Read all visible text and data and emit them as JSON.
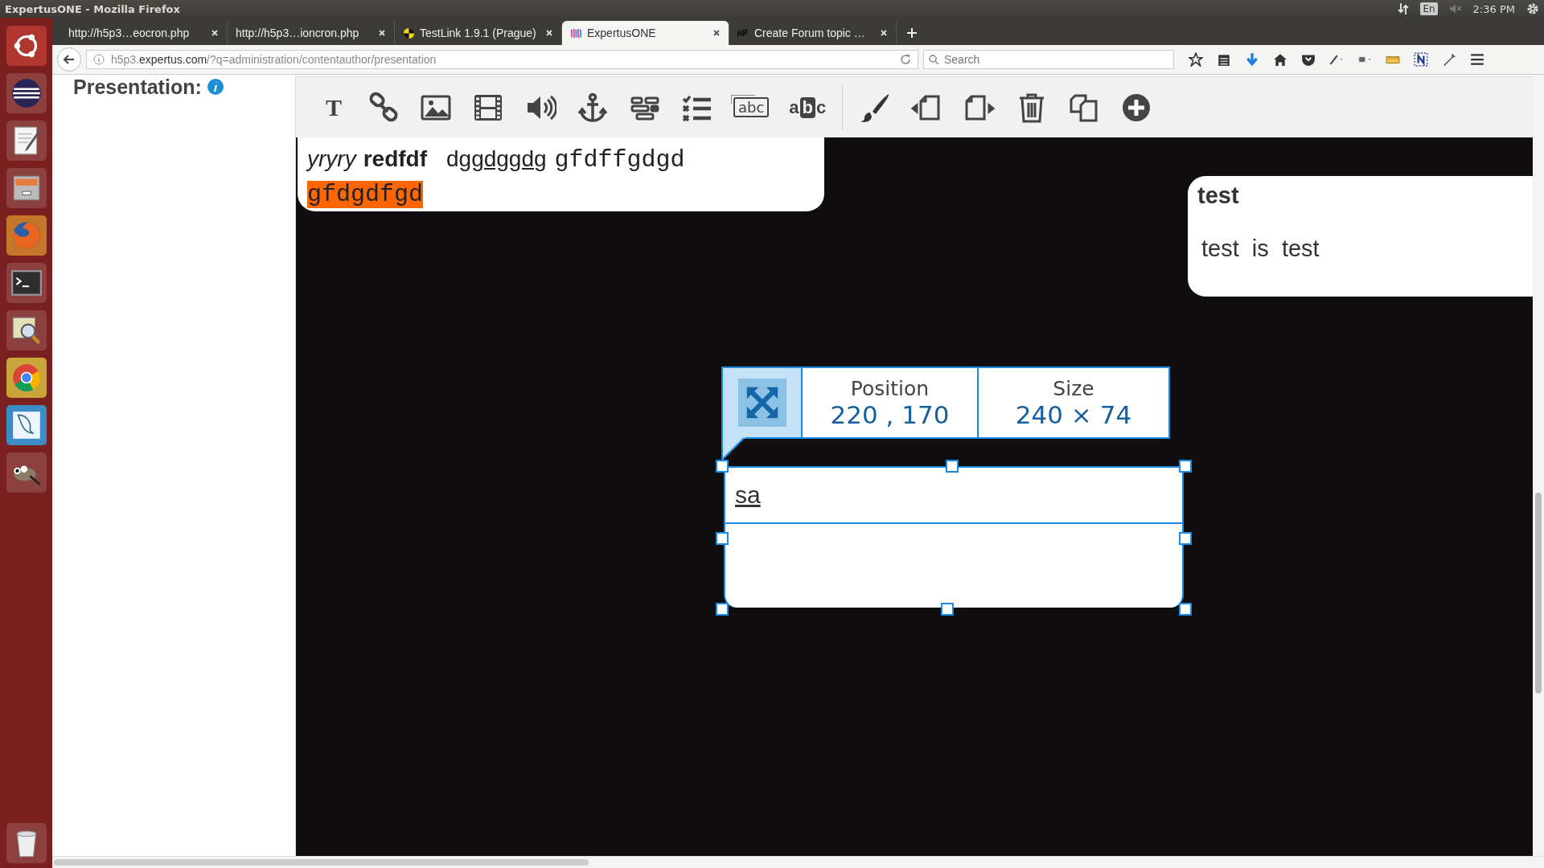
{
  "top_panel": {
    "title": "ExpertusONE - Mozilla Firefox",
    "keyboard": "En",
    "clock": "2:36 PM"
  },
  "launcher": [
    {
      "kind": "ubuntu"
    },
    {
      "kind": "eclipse"
    },
    {
      "kind": "editor"
    },
    {
      "kind": "files"
    },
    {
      "kind": "firefox"
    },
    {
      "kind": "terminal"
    },
    {
      "kind": "viewer"
    },
    {
      "kind": "chrome"
    },
    {
      "kind": "workbench"
    },
    {
      "kind": "gimp"
    },
    {
      "kind": "trash"
    }
  ],
  "tabs": [
    {
      "label": "http://h5p3…eocron.php",
      "selected": false
    },
    {
      "label": "http://h5p3…ioncron.php",
      "selected": false
    },
    {
      "label": "TestLink 1.9.1 (Prague)",
      "selected": false
    },
    {
      "label": "ExpertusONE",
      "selected": true
    },
    {
      "label": "Create Forum topic …",
      "selected": false
    }
  ],
  "address_bar": {
    "prefix": "h5p3.",
    "domain": "expertus.com",
    "path": "/?q=administration/contentauthor/presentation"
  },
  "search": {
    "placeholder": "Search"
  },
  "sidebar": {
    "title": "Presentation:"
  },
  "tools": [
    {
      "kind": "text",
      "label": "T"
    },
    {
      "kind": "link"
    },
    {
      "kind": "image"
    },
    {
      "kind": "video"
    },
    {
      "kind": "audio"
    },
    {
      "kind": "anchor"
    },
    {
      "kind": "drag"
    },
    {
      "kind": "checklist"
    },
    {
      "kind": "blanks",
      "label": "abc"
    },
    {
      "kind": "marker",
      "label": "abc"
    },
    {
      "kind": "separator"
    },
    {
      "kind": "brush"
    },
    {
      "kind": "back"
    },
    {
      "kind": "front"
    },
    {
      "kind": "delete"
    },
    {
      "kind": "copy"
    },
    {
      "kind": "add"
    }
  ],
  "canvas": {
    "text_box": {
      "segments": [
        "yryry",
        "redfdf",
        "d",
        "ggdggd",
        "g",
        "gfdffgdgd",
        "gfdgdfgd"
      ]
    },
    "note_box": {
      "title": "test",
      "body": "test  is  test"
    },
    "geometry": {
      "position_label": "Position",
      "position": "220 , 170",
      "size_label": "Size",
      "size": "240 × 74"
    },
    "selected_box": {
      "text": "sa"
    }
  }
}
